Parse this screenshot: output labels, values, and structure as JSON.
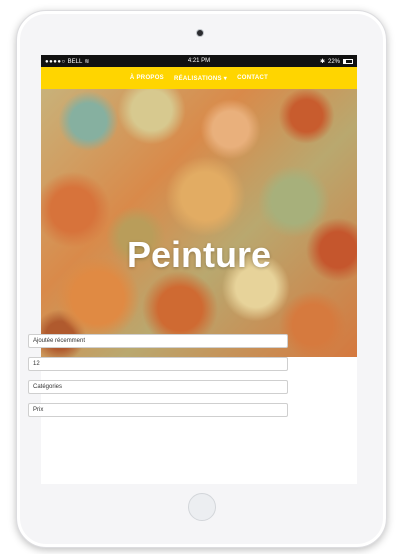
{
  "status_bar": {
    "signal_dots": "●●●●○",
    "carrier": "BELL",
    "time": "4:21 PM",
    "battery_percent": "22%"
  },
  "nav": {
    "items": [
      {
        "label": "À PROPOS"
      },
      {
        "label": "RÉALISATIONS"
      },
      {
        "label": "CONTACT"
      }
    ],
    "dropdown_indicator": "▾"
  },
  "hero": {
    "title": "Peinture"
  },
  "filters": [
    {
      "value": "Ajoutée récemment"
    },
    {
      "value": "12"
    },
    {
      "value": "Catégories"
    },
    {
      "value": "Prix"
    }
  ],
  "colors": {
    "nav_background": "#ffd500",
    "nav_text": "#ffffff"
  }
}
